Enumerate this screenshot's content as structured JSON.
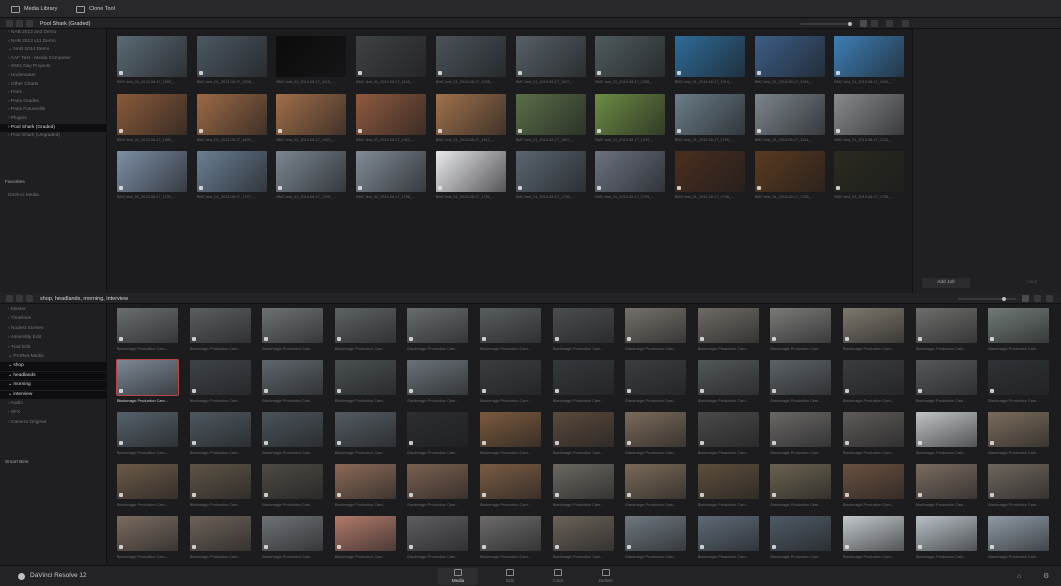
{
  "toolbar": {
    "media_library": "Media Library",
    "clone_tool": "Clone Tool"
  },
  "upper": {
    "bin_title": "Pool Shark (Graded)",
    "tree": [
      {
        "label": "› NAB 2013 and Demo",
        "sel": false
      },
      {
        "label": "› NAB 2013 v11 Demo",
        "sel": false
      },
      {
        "label": "⌄ NAB 2014 Demo",
        "sel": false
      },
      {
        "label": "› AAF Test - Media Composer",
        "sel": false
      },
      {
        "label": "› SMG Day Projects",
        "sel": false
      },
      {
        "label": "› Underwater",
        "sel": false
      },
      {
        "label": "› Other Charts",
        "sel": false
      },
      {
        "label": "› Paris",
        "sel": false
      },
      {
        "label": "› Paris Grades",
        "sel": false
      },
      {
        "label": "› Paris Futureville",
        "sel": false
      },
      {
        "label": "› Plugins",
        "sel": false
      },
      {
        "label": "› Pool Shark (Graded)",
        "sel": true
      },
      {
        "label": "› Pool Shark (Ungraded)",
        "sel": false
      }
    ],
    "favorites_label": "Favorites",
    "favorite_item": "DaVinci Media",
    "captions": [
      "BMC test_01_2013-08-17_1009_...",
      "BMC test_01_2013-08-17_1008_...",
      "BMC test_01_2013-08-17_1113_...",
      "BMC test_01_2013-08-17_1118_...",
      "BMC test_01_2013-08-17_1205_...",
      "BMC test_01_2013-08-17_1207_...",
      "BMC test_01_2013-08-17_1208_...",
      "BMC test_01_2013-08-17_1014_...",
      "BMC test_01_2013-08-17_1044_...",
      "BMC test_01_2013-08-17_1044_...",
      "BMC test_01_2013-08-17_1409_...",
      "BMC test_01_2013-08-17_1409_...",
      "BMC test_02_2013-08-17_1410_...",
      "BMC test_02_2013-08-17_1411_...",
      "BMC test_01_2013-08-17_1411_...",
      "BMC test_01_2013-08-17_1657_...",
      "BMC test_01_2013-08-17_1419_...",
      "BMC test_01_2013-08-17_1700_...",
      "BMC test_01_2013-08-17_1124_...",
      "BMC test_01_2013-08-17_1123_...",
      "BMC test_01_2013-08-17_1720_...",
      "BMC test_01_2013-08-17_1727_...",
      "BMC test_01_2013-08-17_1705_...",
      "BMC test_01_2013-08-17_1706_...",
      "BMC test_01_2013-08-17_1751_...",
      "BMC test_01_2013-08-17_1708_...",
      "BMC test_01_2013-08-17_1709_...",
      "BMC test_01_2013-08-17_1748_...",
      "BMC test_01_2013-08-17_1755_...",
      "BMC test_02_2013-08-17_1755_..."
    ],
    "add_job": "Add Job",
    "clear": "Clear"
  },
  "lower": {
    "bin_title": "shop, headlands, morning, interview",
    "tree": [
      {
        "label": "› Master",
        "sel": false
      },
      {
        "label": "› Timelines",
        "sel": false
      },
      {
        "label": "› Nodest Scenes",
        "sel": false
      },
      {
        "label": "› Assembly Edit",
        "sel": false
      },
      {
        "label": "› Trad Edit",
        "sel": false
      },
      {
        "label": "⌄ ProRes Media",
        "sel": false
      },
      {
        "label": "⌄ shop",
        "sel": true
      },
      {
        "label": "⌄ headlands",
        "sel": true
      },
      {
        "label": "⌄ morning",
        "sel": true
      },
      {
        "label": "⌄ interview",
        "sel": true
      },
      {
        "label": "› Audio",
        "sel": false
      },
      {
        "label": "› SFX",
        "sel": false
      },
      {
        "label": "› Camera Original",
        "sel": false
      }
    ],
    "smart_bins_label": "Smart Bins",
    "caption": "Blackmagic Production Cam..."
  },
  "bottombar": {
    "app_name": "DaVinci Resolve 12",
    "pages": [
      {
        "label": "Media",
        "active": true
      },
      {
        "label": "Edit",
        "active": false
      },
      {
        "label": "Color",
        "active": false
      },
      {
        "label": "Deliver",
        "active": false
      }
    ]
  },
  "colors": {
    "accent": "#b44",
    "panel": "#1b1b1d",
    "selected_row": "#0e0e10"
  }
}
